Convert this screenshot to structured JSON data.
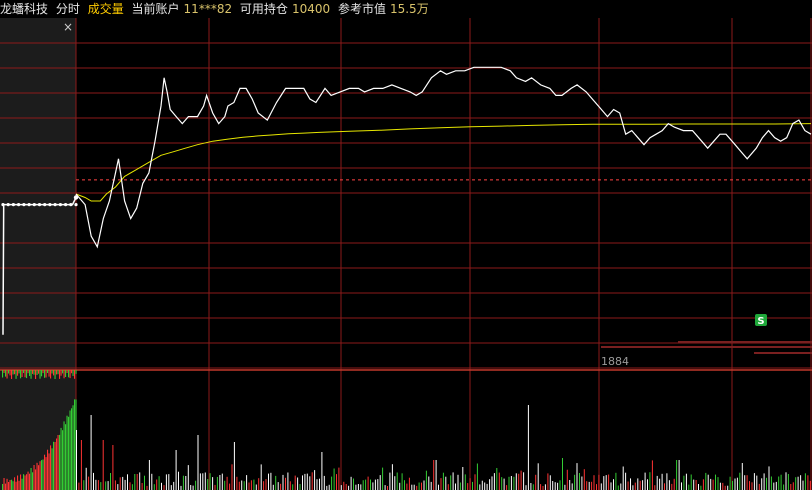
{
  "header": {
    "stock_name": "龙蟠科技",
    "mode_tab": "分时",
    "indicator_tab": "成交量",
    "account_label": "当前账户",
    "account_value": "11***82",
    "position_label": "可用持仓",
    "position_value": "10400",
    "market_value_label": "参考市值",
    "market_value_value": "15.5万"
  },
  "close_symbol": "×",
  "sell_marker": "S",
  "ask_volume_label": "1884",
  "colors": {
    "background": "#000000",
    "grid": "#8b1a1a",
    "price_line": "#ffffff",
    "avg_line": "#e6e600",
    "up_bar": "#ff3333",
    "down_bar": "#33cc33",
    "ref_line": "#ff4444",
    "sell_marker_bg": "#1fa83a"
  },
  "chart_data": {
    "type": "line",
    "title": "",
    "xlabel": "",
    "ylabel": "",
    "ylim": [
      0,
      100
    ],
    "reference_level": 54,
    "price": [
      [
        0,
        50
      ],
      [
        3,
        47
      ],
      [
        5,
        38
      ],
      [
        7,
        35
      ],
      [
        9,
        43
      ],
      [
        11,
        48
      ],
      [
        13,
        56
      ],
      [
        14,
        60
      ],
      [
        16,
        48
      ],
      [
        18,
        43
      ],
      [
        20,
        46
      ],
      [
        22,
        53
      ],
      [
        24,
        56
      ],
      [
        26,
        65
      ],
      [
        28,
        75
      ],
      [
        29,
        83
      ],
      [
        30,
        79
      ],
      [
        31,
        74
      ],
      [
        33,
        72
      ],
      [
        35,
        70
      ],
      [
        37,
        72
      ],
      [
        40,
        72
      ],
      [
        42,
        75
      ],
      [
        43,
        78
      ],
      [
        45,
        73
      ],
      [
        47,
        70
      ],
      [
        49,
        72
      ],
      [
        50,
        75
      ],
      [
        52,
        76
      ],
      [
        54,
        80
      ],
      [
        56,
        80
      ],
      [
        58,
        77
      ],
      [
        60,
        73
      ],
      [
        63,
        71
      ],
      [
        66,
        76
      ],
      [
        69,
        80
      ],
      [
        72,
        80
      ],
      [
        75,
        80
      ],
      [
        77,
        77
      ],
      [
        79,
        76
      ],
      [
        82,
        80
      ],
      [
        84,
        78
      ],
      [
        87,
        79
      ],
      [
        90,
        80
      ],
      [
        93,
        80
      ],
      [
        95,
        79
      ],
      [
        98,
        80
      ],
      [
        101,
        80
      ],
      [
        104,
        81
      ],
      [
        107,
        80
      ],
      [
        110,
        79
      ],
      [
        112,
        78
      ],
      [
        114,
        79
      ],
      [
        117,
        83
      ],
      [
        120,
        85
      ],
      [
        122,
        84
      ],
      [
        125,
        85
      ],
      [
        128,
        85
      ],
      [
        131,
        86
      ],
      [
        134,
        86
      ],
      [
        137,
        86
      ],
      [
        140,
        86
      ],
      [
        143,
        85
      ],
      [
        145,
        83
      ],
      [
        148,
        82
      ],
      [
        150,
        83
      ],
      [
        153,
        81
      ],
      [
        156,
        80
      ],
      [
        158,
        78
      ],
      [
        160,
        78
      ],
      [
        163,
        80
      ],
      [
        165,
        81
      ],
      [
        168,
        79
      ],
      [
        170,
        77
      ],
      [
        172,
        75
      ],
      [
        175,
        72
      ],
      [
        177,
        74
      ],
      [
        179,
        73
      ],
      [
        181,
        67
      ],
      [
        183,
        68
      ],
      [
        185,
        66
      ],
      [
        187,
        64
      ],
      [
        189,
        66
      ],
      [
        191,
        67
      ],
      [
        193,
        68
      ],
      [
        195,
        70
      ],
      [
        197,
        69
      ],
      [
        200,
        68
      ],
      [
        203,
        68
      ],
      [
        206,
        65
      ],
      [
        208,
        63
      ],
      [
        210,
        65
      ],
      [
        212,
        67
      ],
      [
        214,
        67
      ],
      [
        217,
        64
      ],
      [
        219,
        62
      ],
      [
        221,
        60
      ],
      [
        224,
        63
      ],
      [
        226,
        66
      ],
      [
        228,
        68
      ],
      [
        230,
        66
      ],
      [
        232,
        65
      ],
      [
        234,
        66
      ],
      [
        236,
        70
      ],
      [
        238,
        71
      ],
      [
        240,
        68
      ],
      [
        242,
        67
      ]
    ],
    "avg": [
      [
        0,
        50
      ],
      [
        3,
        49
      ],
      [
        5,
        48
      ],
      [
        8,
        48
      ],
      [
        10,
        50
      ],
      [
        13,
        52
      ],
      [
        16,
        55
      ],
      [
        20,
        57
      ],
      [
        24,
        59
      ],
      [
        28,
        61
      ],
      [
        32,
        62
      ],
      [
        36,
        63
      ],
      [
        40,
        64
      ],
      [
        45,
        65
      ],
      [
        50,
        65.6
      ],
      [
        55,
        66.1
      ],
      [
        60,
        66.5
      ],
      [
        65,
        66.8
      ],
      [
        70,
        67.1
      ],
      [
        75,
        67.3
      ],
      [
        80,
        67.5
      ],
      [
        90,
        67.8
      ],
      [
        100,
        68.1
      ],
      [
        110,
        68.5
      ],
      [
        120,
        68.8
      ],
      [
        130,
        69.1
      ],
      [
        140,
        69.3
      ],
      [
        150,
        69.5
      ],
      [
        160,
        69.7
      ],
      [
        170,
        69.8
      ],
      [
        180,
        69.8
      ],
      [
        190,
        69.8
      ],
      [
        200,
        69.9
      ],
      [
        210,
        69.9
      ],
      [
        220,
        69.9
      ],
      [
        230,
        69.9
      ],
      [
        242,
        70
      ]
    ],
    "pre_price": [
      [
        0,
        10
      ],
      [
        0.2,
        47
      ],
      [
        0.5,
        47
      ],
      [
        20,
        47
      ],
      [
        21,
        49
      ]
    ]
  }
}
